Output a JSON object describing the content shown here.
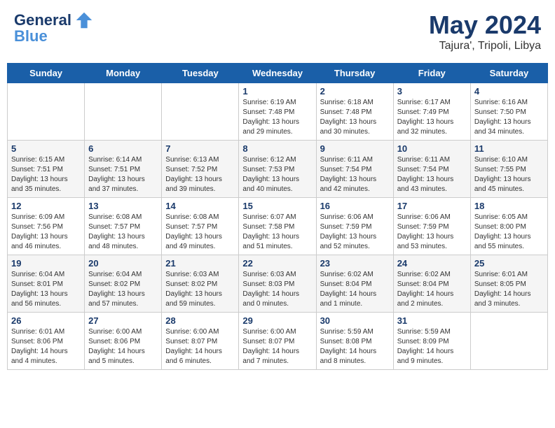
{
  "header": {
    "logo_line1": "General",
    "logo_line2": "Blue",
    "month_year": "May 2024",
    "location": "Tajura', Tripoli, Libya"
  },
  "days_of_week": [
    "Sunday",
    "Monday",
    "Tuesday",
    "Wednesday",
    "Thursday",
    "Friday",
    "Saturday"
  ],
  "weeks": [
    [
      {
        "day": "",
        "info": ""
      },
      {
        "day": "",
        "info": ""
      },
      {
        "day": "",
        "info": ""
      },
      {
        "day": "1",
        "info": "Sunrise: 6:19 AM\nSunset: 7:48 PM\nDaylight: 13 hours and 29 minutes."
      },
      {
        "day": "2",
        "info": "Sunrise: 6:18 AM\nSunset: 7:48 PM\nDaylight: 13 hours and 30 minutes."
      },
      {
        "day": "3",
        "info": "Sunrise: 6:17 AM\nSunset: 7:49 PM\nDaylight: 13 hours and 32 minutes."
      },
      {
        "day": "4",
        "info": "Sunrise: 6:16 AM\nSunset: 7:50 PM\nDaylight: 13 hours and 34 minutes."
      }
    ],
    [
      {
        "day": "5",
        "info": "Sunrise: 6:15 AM\nSunset: 7:51 PM\nDaylight: 13 hours and 35 minutes."
      },
      {
        "day": "6",
        "info": "Sunrise: 6:14 AM\nSunset: 7:51 PM\nDaylight: 13 hours and 37 minutes."
      },
      {
        "day": "7",
        "info": "Sunrise: 6:13 AM\nSunset: 7:52 PM\nDaylight: 13 hours and 39 minutes."
      },
      {
        "day": "8",
        "info": "Sunrise: 6:12 AM\nSunset: 7:53 PM\nDaylight: 13 hours and 40 minutes."
      },
      {
        "day": "9",
        "info": "Sunrise: 6:11 AM\nSunset: 7:54 PM\nDaylight: 13 hours and 42 minutes."
      },
      {
        "day": "10",
        "info": "Sunrise: 6:11 AM\nSunset: 7:54 PM\nDaylight: 13 hours and 43 minutes."
      },
      {
        "day": "11",
        "info": "Sunrise: 6:10 AM\nSunset: 7:55 PM\nDaylight: 13 hours and 45 minutes."
      }
    ],
    [
      {
        "day": "12",
        "info": "Sunrise: 6:09 AM\nSunset: 7:56 PM\nDaylight: 13 hours and 46 minutes."
      },
      {
        "day": "13",
        "info": "Sunrise: 6:08 AM\nSunset: 7:57 PM\nDaylight: 13 hours and 48 minutes."
      },
      {
        "day": "14",
        "info": "Sunrise: 6:08 AM\nSunset: 7:57 PM\nDaylight: 13 hours and 49 minutes."
      },
      {
        "day": "15",
        "info": "Sunrise: 6:07 AM\nSunset: 7:58 PM\nDaylight: 13 hours and 51 minutes."
      },
      {
        "day": "16",
        "info": "Sunrise: 6:06 AM\nSunset: 7:59 PM\nDaylight: 13 hours and 52 minutes."
      },
      {
        "day": "17",
        "info": "Sunrise: 6:06 AM\nSunset: 7:59 PM\nDaylight: 13 hours and 53 minutes."
      },
      {
        "day": "18",
        "info": "Sunrise: 6:05 AM\nSunset: 8:00 PM\nDaylight: 13 hours and 55 minutes."
      }
    ],
    [
      {
        "day": "19",
        "info": "Sunrise: 6:04 AM\nSunset: 8:01 PM\nDaylight: 13 hours and 56 minutes."
      },
      {
        "day": "20",
        "info": "Sunrise: 6:04 AM\nSunset: 8:02 PM\nDaylight: 13 hours and 57 minutes."
      },
      {
        "day": "21",
        "info": "Sunrise: 6:03 AM\nSunset: 8:02 PM\nDaylight: 13 hours and 59 minutes."
      },
      {
        "day": "22",
        "info": "Sunrise: 6:03 AM\nSunset: 8:03 PM\nDaylight: 14 hours and 0 minutes."
      },
      {
        "day": "23",
        "info": "Sunrise: 6:02 AM\nSunset: 8:04 PM\nDaylight: 14 hours and 1 minute."
      },
      {
        "day": "24",
        "info": "Sunrise: 6:02 AM\nSunset: 8:04 PM\nDaylight: 14 hours and 2 minutes."
      },
      {
        "day": "25",
        "info": "Sunrise: 6:01 AM\nSunset: 8:05 PM\nDaylight: 14 hours and 3 minutes."
      }
    ],
    [
      {
        "day": "26",
        "info": "Sunrise: 6:01 AM\nSunset: 8:06 PM\nDaylight: 14 hours and 4 minutes."
      },
      {
        "day": "27",
        "info": "Sunrise: 6:00 AM\nSunset: 8:06 PM\nDaylight: 14 hours and 5 minutes."
      },
      {
        "day": "28",
        "info": "Sunrise: 6:00 AM\nSunset: 8:07 PM\nDaylight: 14 hours and 6 minutes."
      },
      {
        "day": "29",
        "info": "Sunrise: 6:00 AM\nSunset: 8:07 PM\nDaylight: 14 hours and 7 minutes."
      },
      {
        "day": "30",
        "info": "Sunrise: 5:59 AM\nSunset: 8:08 PM\nDaylight: 14 hours and 8 minutes."
      },
      {
        "day": "31",
        "info": "Sunrise: 5:59 AM\nSunset: 8:09 PM\nDaylight: 14 hours and 9 minutes."
      },
      {
        "day": "",
        "info": ""
      }
    ]
  ]
}
